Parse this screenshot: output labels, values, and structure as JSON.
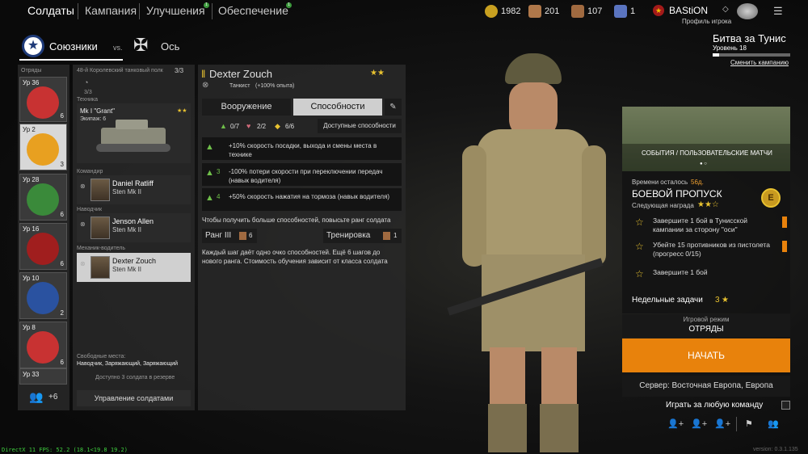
{
  "nav": {
    "soldiers": "Солдаты",
    "campaign": "Кампания",
    "upgrades": "Улучшения",
    "supply": "Обеспечение",
    "upgrades_badge": "1",
    "supply_badge": "1"
  },
  "resources": {
    "gold": "1982",
    "cards1": "201",
    "cards2": "107",
    "cards3": "1"
  },
  "player": {
    "name": "BAStiON",
    "profile": "Профиль игрока"
  },
  "campaign": {
    "title": "Битва за Тунис",
    "level": "Уровень 18",
    "change": "Сменить кампанию",
    "progress": 0.08
  },
  "factions": {
    "allies": "Союзники",
    "vs": "vs.",
    "axis": "Ось"
  },
  "squads": {
    "header": "Отряды",
    "items": [
      {
        "lvl": "Ур 36",
        "count": "6"
      },
      {
        "lvl": "Ур 2",
        "count": "3"
      },
      {
        "lvl": "Ур 28",
        "count": "6"
      },
      {
        "lvl": "Ур 16",
        "count": "6"
      },
      {
        "lvl": "Ур 10",
        "count": "2"
      },
      {
        "lvl": "Ур 8",
        "count": "6"
      },
      {
        "lvl": "Ур 33",
        "count": ""
      }
    ],
    "more": "+6"
  },
  "unit": {
    "name": "48-й Королевский танковый полк",
    "count": "3/3",
    "engine_count": "3/3",
    "tech_label": "Техника",
    "vehicle": "Mk I \"Grant\"",
    "crew": "Экипаж: 6",
    "commander_label": "Командир",
    "gunner_label": "Наводчик",
    "driver_label": "Механик-водитель",
    "soldiers": [
      {
        "name": "Daniel Ratliff",
        "weapon": "Sten Mk II"
      },
      {
        "name": "Jenson Allen",
        "weapon": "Sten Mk II"
      },
      {
        "name": "Dexter Zouch",
        "weapon": "Sten Mk II"
      }
    ],
    "free_label": "Свободные места:",
    "free_list": "Наводчик, Заряжающий, Заряжающий",
    "reserve": "Доступно 3 солдата в резерве",
    "manage": "Управление солдатами"
  },
  "detail": {
    "name": "Dexter Zouch",
    "class": "Танкист",
    "bonus": "(+100% опыта)",
    "tab_weapons": "Вооружение",
    "tab_abilities": "Способности",
    "stat1": "0/7",
    "stat2": "2/2",
    "stat3": "6/6",
    "available": "Доступные способности",
    "skills": [
      {
        "num": "",
        "text": "+10% скорость посадки, выхода и смены места в технике"
      },
      {
        "num": "3",
        "text": "-100% потери скорости при переключении передач (навык водителя)"
      },
      {
        "num": "4",
        "text": "+50% скорость нажатия на тормоза (навык водителя)"
      }
    ],
    "hint": "Чтобы получить больше способностей, повысьте ранг солдата",
    "rank": "Ранг III",
    "rank_val": "6",
    "training": "Тренировка",
    "training_val": "1",
    "desc": "Каждый шаг даёт одно очко способностей. Ещё 6 шагов до нового ранга. Стоимость обучения зависит от класса солдата"
  },
  "events": {
    "banner": "СОБЫТИЯ / ПОЛЬЗОВАТЕЛЬСКИЕ МАТЧИ",
    "time_label": "Времени осталось",
    "time": "56д.",
    "pass": "БОЕВОЙ ПРОПУСК",
    "next_reward": "Следующая награда",
    "tasks": [
      "Завершите 1 бой в Тунисской кампании за сторону \"оси\"",
      "Убейте 15 противников из пистолета (прогресс 0/15)",
      "Завершите 1 бой"
    ],
    "weekly": "Недельные задачи",
    "weekly_count": "3",
    "mode_label": "Игровой режим",
    "mode": "ОТРЯДЫ",
    "start": "НАЧАТЬ",
    "server": "Сервер: Восточная Европа, Европа",
    "any_team": "Играть за любую команду"
  },
  "footer": {
    "fps": "DirectX 11 FPS: 52.2 (18.1<19.8 19.2)",
    "version": "version: 0.3.1.135"
  },
  "colors": {
    "accent": "#e8820c",
    "green": "#6fbf4a",
    "gold": "#e8c230"
  }
}
